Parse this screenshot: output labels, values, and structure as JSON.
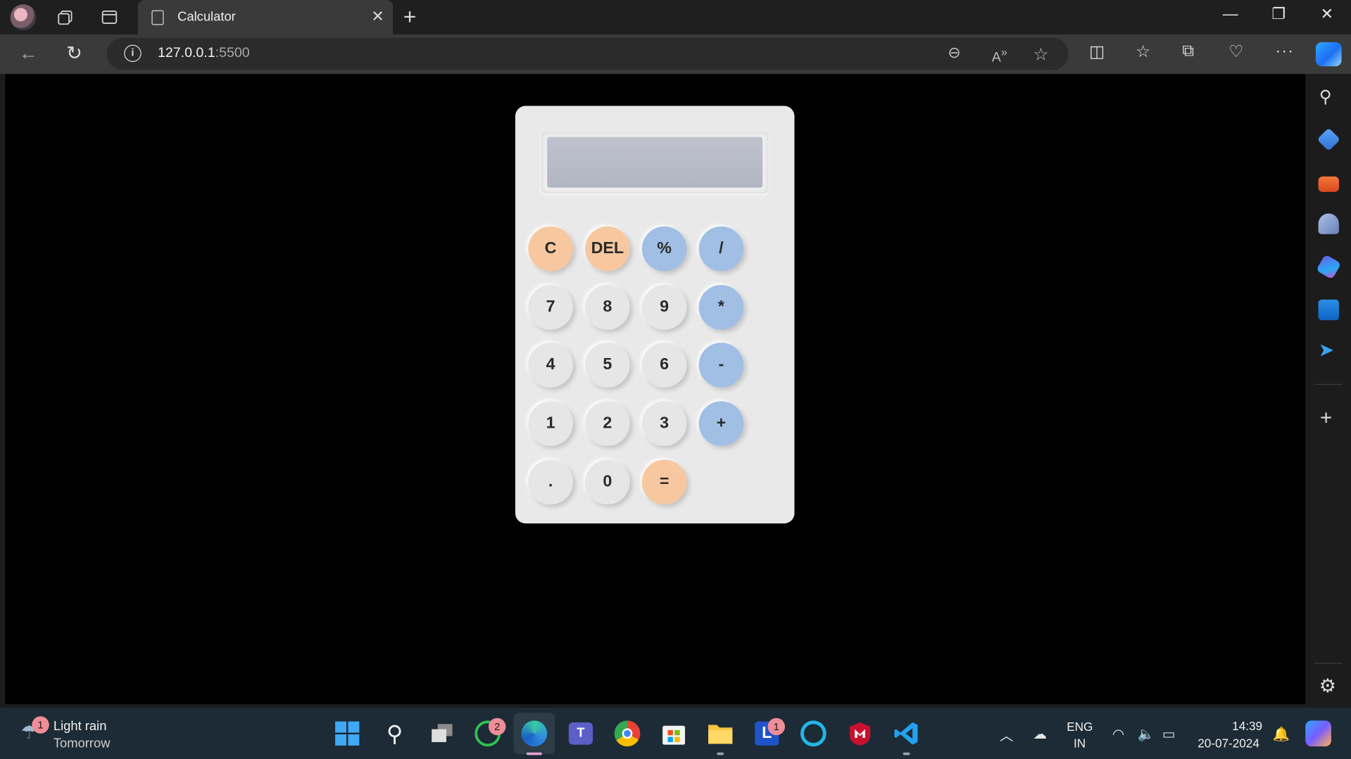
{
  "browser": {
    "tab_title": "Calculator",
    "url_host": "127.0.0.1",
    "url_port": ":5500",
    "icons": [
      "profile-avatar-icon",
      "workspaces-icon",
      "vertical-tabs-icon",
      "back-icon",
      "refresh-icon",
      "info-icon",
      "zoom-out-icon",
      "read-aloud-icon",
      "favorite-star-icon",
      "split-screen-icon",
      "favorites-icon",
      "collections-icon",
      "browser-essentials-icon",
      "more-icon",
      "copilot-icon"
    ]
  },
  "sidebar": {
    "icons": [
      "search-icon",
      "shopping-tag-icon",
      "tools-icon",
      "games-icon",
      "office-icon",
      "outlook-icon",
      "telegram-icon",
      "add-icon",
      "settings-icon"
    ]
  },
  "calculator": {
    "display_value": "",
    "keys": {
      "clear": "C",
      "delete": "DEL",
      "percent": "%",
      "divide": "/",
      "seven": "7",
      "eight": "8",
      "nine": "9",
      "multiply": "*",
      "four": "4",
      "five": "5",
      "six": "6",
      "subtract": "-",
      "one": "1",
      "two": "2",
      "three": "3",
      "add": "+",
      "decimal": ".",
      "zero": "0",
      "equals": "="
    },
    "colors": {
      "body": "#e9e9e9",
      "display": "#b9bcc7",
      "operator_key": "#a1bfe4",
      "function_key": "#f7c8a0",
      "number_key": "#e6e6e6"
    }
  },
  "taskbar": {
    "weather_title": "Light rain",
    "weather_sub": "Tomorrow",
    "weather_badge": "1",
    "whatsapp_badge": "2",
    "launcher_badge": "1",
    "language": "ENG",
    "region": "IN",
    "time": "14:39",
    "date": "20-07-2024"
  }
}
